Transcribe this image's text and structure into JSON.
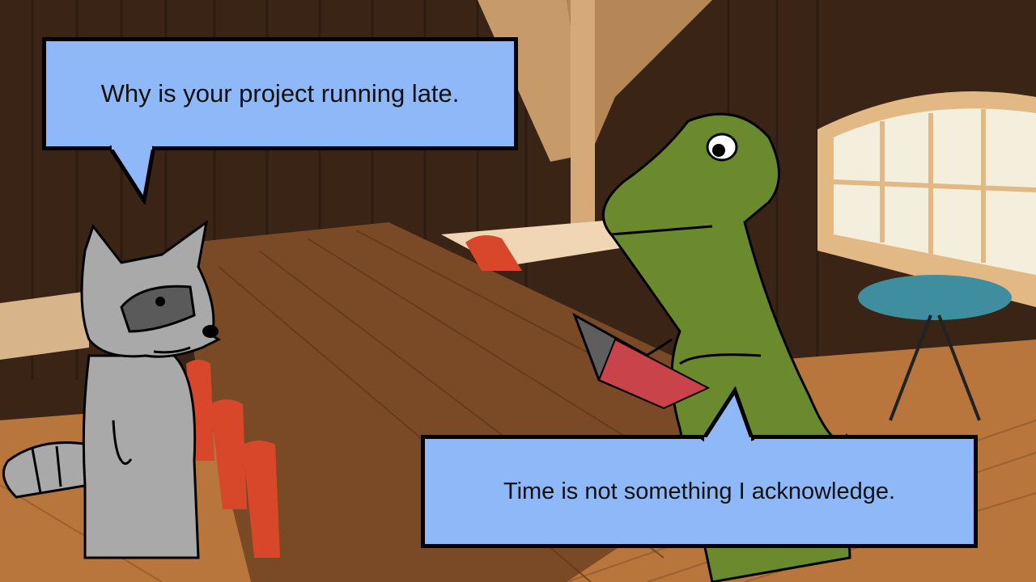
{
  "scene": {
    "speech_top": {
      "text": "Why is your project running late.",
      "speaker": "raccoon"
    },
    "speech_bottom": {
      "text": "Time is not something I acknowledge.",
      "speaker": "dinosaur"
    }
  },
  "icons": {
    "raccoon": "raccoon-character",
    "dinosaur": "trex-character",
    "laptop": "laptop-icon"
  },
  "colors": {
    "bubble_fill": "#8fb8f8",
    "dino_green": "#6b8a2e",
    "raccoon_gray": "#a9a9a9",
    "chair_red": "#d9472b",
    "wood": "#7a4a26"
  }
}
